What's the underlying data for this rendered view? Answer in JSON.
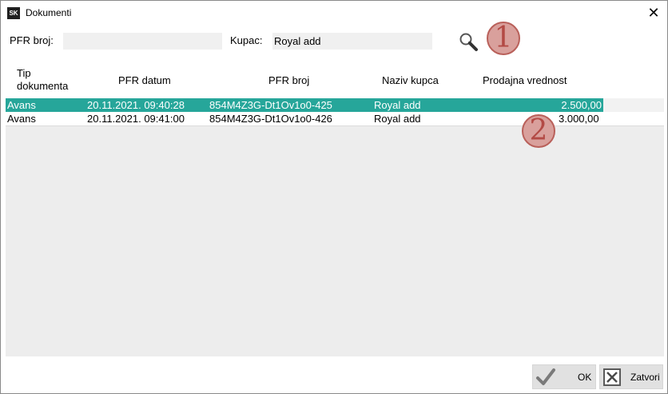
{
  "window": {
    "title": "Dokumenti",
    "icon_text": "SK",
    "close_glyph": "✕"
  },
  "filters": {
    "pfr_label": "PFR broj:",
    "pfr_value": "",
    "kupac_label": "Kupac:",
    "kupac_value": "Royal add"
  },
  "badges": {
    "one": "1",
    "two": "2"
  },
  "table": {
    "columns": [
      "Tip dokumenta",
      "PFR datum",
      "PFR broj",
      "Naziv kupca",
      "Prodajna vrednost"
    ],
    "col_tip_line1": "Tip",
    "col_tip_line2": "dokumenta",
    "rows": [
      {
        "tip": "Avans",
        "datum": "20.11.2021. 09:40:28",
        "broj": "854M4Z3G-Dt1Ov1o0-425",
        "kupac": "Royal add",
        "vrednost": "2.500,00",
        "selected": true
      },
      {
        "tip": "Avans",
        "datum": "20.11.2021. 09:41:00",
        "broj": "854M4Z3G-Dt1Ov1o0-426",
        "kupac": "Royal add",
        "vrednost": "3.000,00",
        "selected": false
      }
    ]
  },
  "buttons": {
    "ok": "OK",
    "close": "Zatvori"
  },
  "colors": {
    "selection": "#26a69a",
    "badge_fill": "#d9a09c",
    "badge_text": "#b34a45"
  }
}
